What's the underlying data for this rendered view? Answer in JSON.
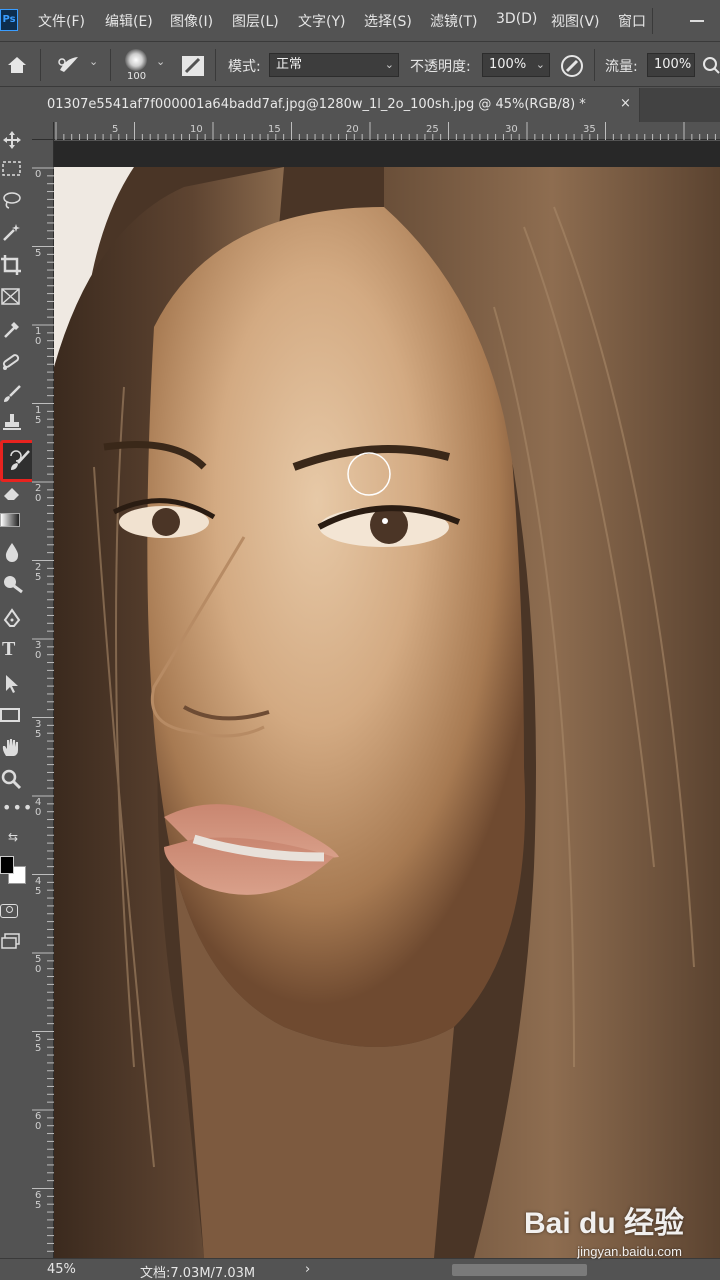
{
  "app": {
    "logo": "Ps"
  },
  "menu": [
    "文件(F)",
    "编辑(E)",
    "图像(I)",
    "图层(L)",
    "文字(Y)",
    "选择(S)",
    "滤镜(T)",
    "3D(D)",
    "视图(V)",
    "窗口"
  ],
  "options": {
    "brush_size": "100",
    "mode_label": "模式:",
    "mode_value": "正常",
    "opacity_label": "不透明度:",
    "opacity_value": "100%",
    "flow_label": "流量:",
    "flow_value": "100%"
  },
  "document": {
    "tab_title": "01307e5541af7f000001a64badd7af.jpg@1280w_1l_2o_100sh.jpg @ 45%(RGB/8) *",
    "close_glyph": "×"
  },
  "ruler_top": [
    "5",
    "10",
    "15",
    "20",
    "25",
    "30",
    "35"
  ],
  "ruler_left": [
    "0",
    "5",
    "1\n0",
    "1\n5",
    "2\n0",
    "2\n5",
    "3\n0",
    "3\n5",
    "4\n0",
    "4\n5",
    "5\n0",
    "5\n5",
    "6\n0",
    "6\n5"
  ],
  "tools": [
    "move-tool",
    "marquee-tool",
    "lasso-tool",
    "magic-wand-tool",
    "crop-tool",
    "frame-tool",
    "eyedropper-tool",
    "healing-brush-tool",
    "brush-tool",
    "clone-stamp-tool",
    "history-brush-tool",
    "eraser-tool",
    "gradient-tool",
    "blur-tool",
    "dodge-tool",
    "pen-tool",
    "type-tool",
    "path-selection-tool",
    "rectangle-tool",
    "hand-tool",
    "zoom-tool",
    "more-tools"
  ],
  "selected_tool": "history-brush-tool",
  "status": {
    "zoom": "45%",
    "doc_size": "文档:7.03M/7.03M",
    "arrow": "›"
  },
  "watermark": {
    "brand": "Bai du 经验",
    "url": "jingyan.baidu.com"
  },
  "colors": {
    "ui_bg": "#535353",
    "canvas_bg": "#282828",
    "highlight": "#e8231f"
  }
}
